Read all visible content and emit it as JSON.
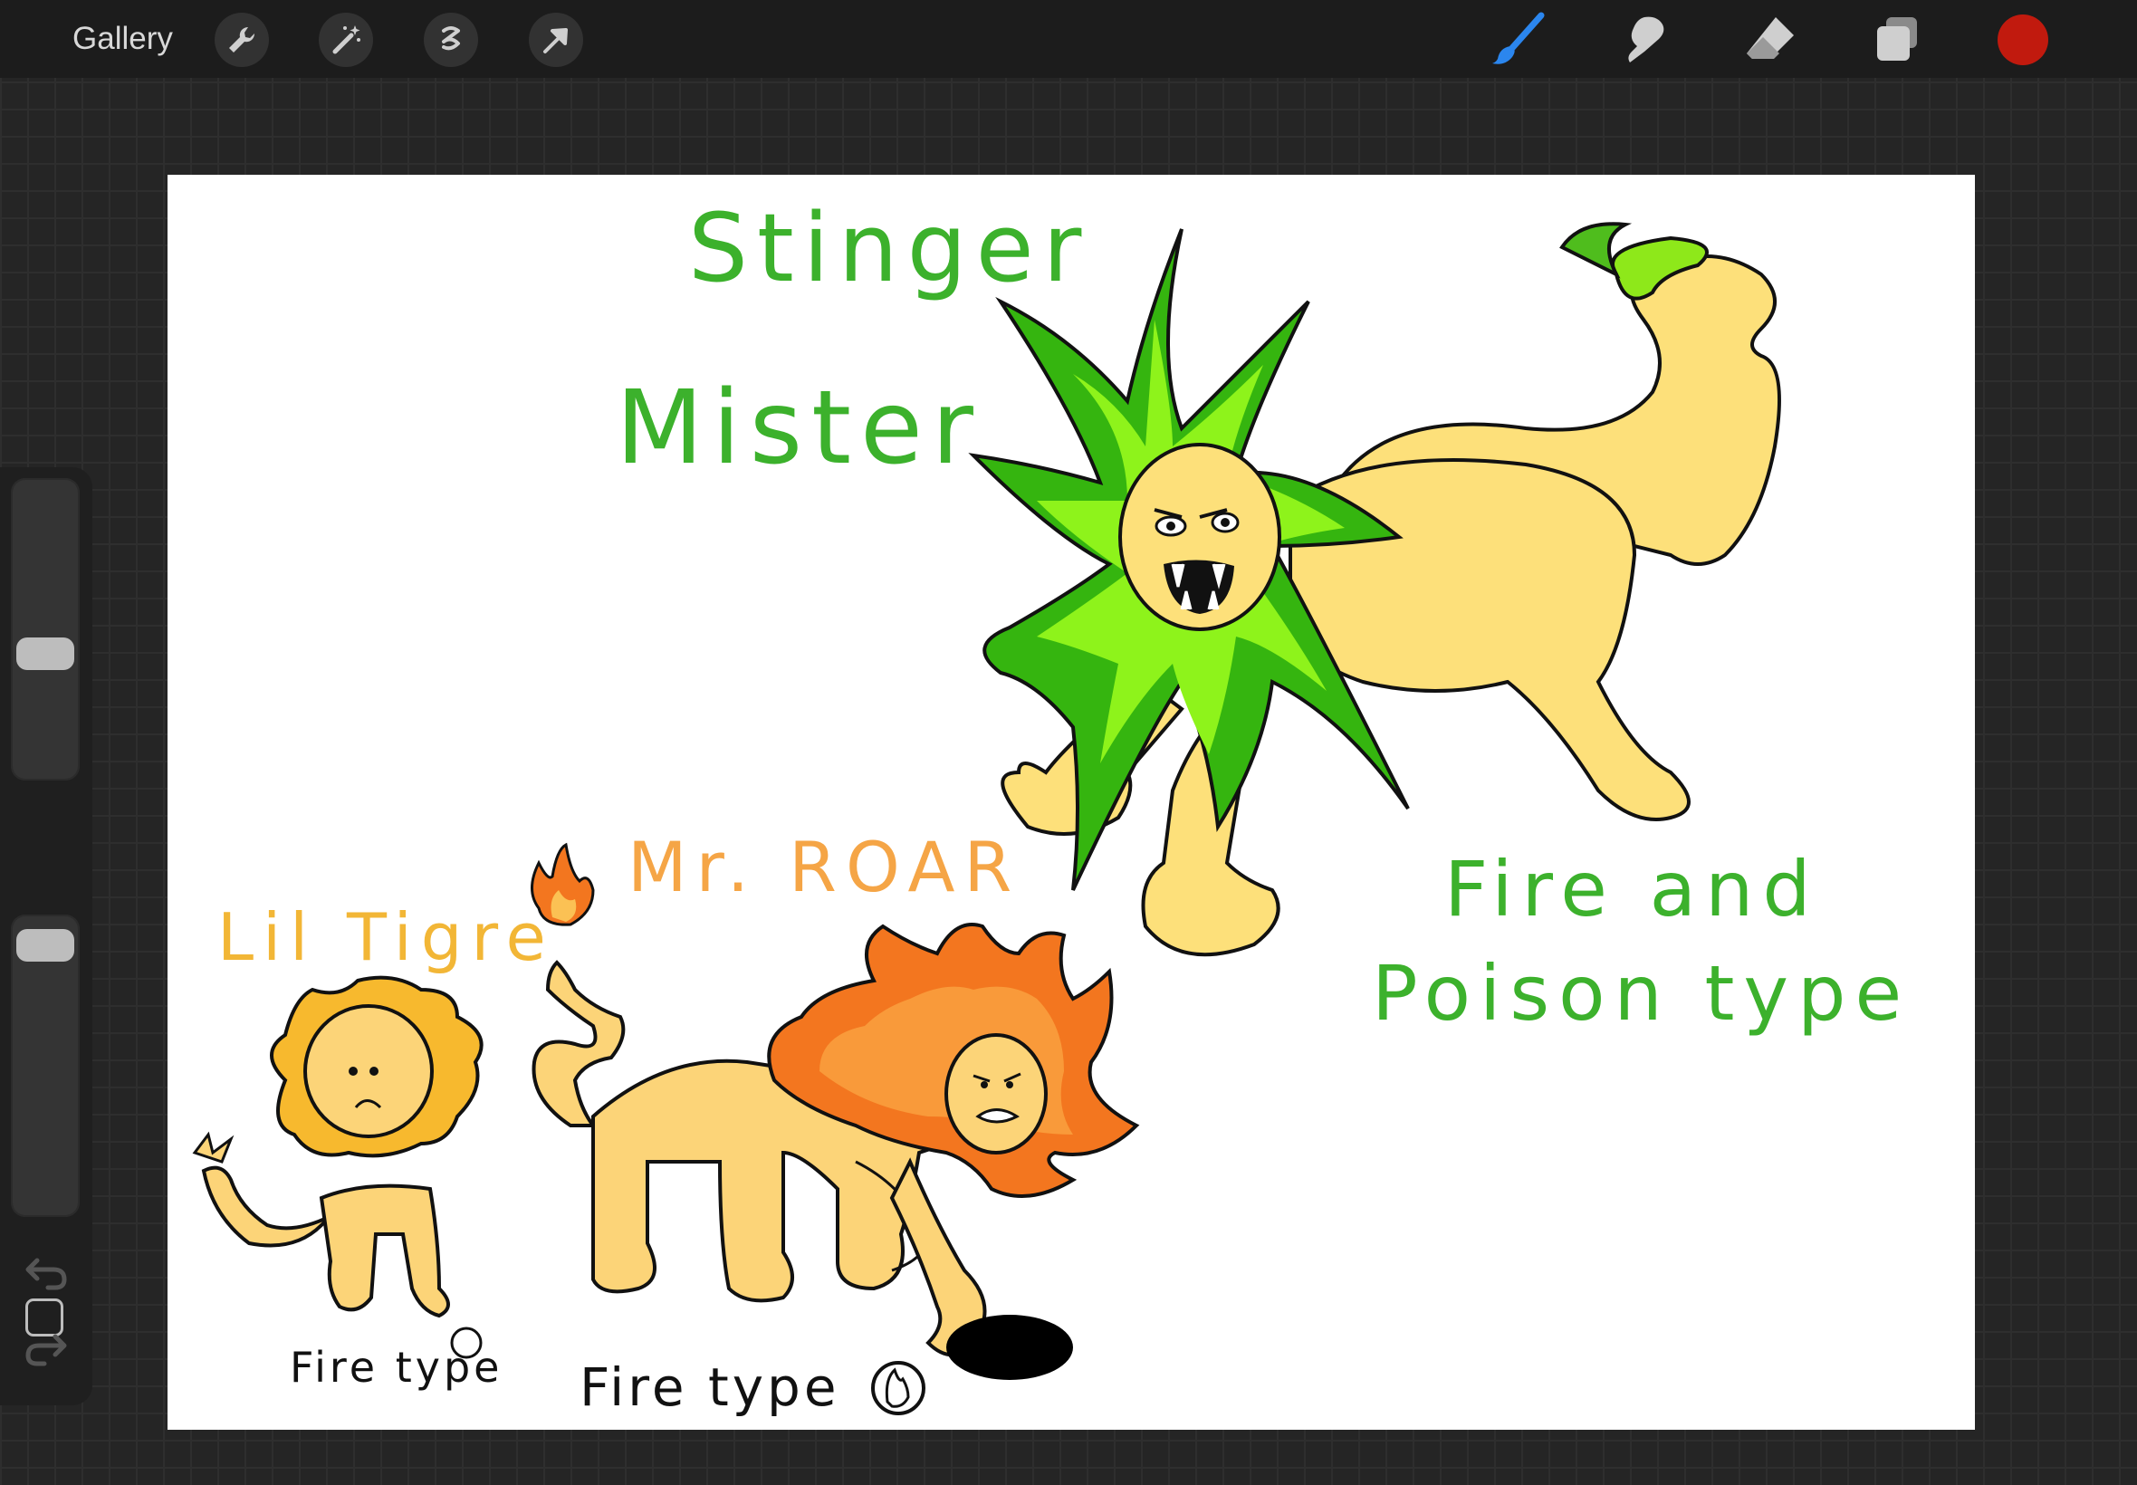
{
  "topbar": {
    "gallery_label": "Gallery",
    "left_tools": [
      "wrench-icon",
      "magic-wand-icon",
      "selection-icon",
      "transform-arrow-icon"
    ],
    "right_tools": [
      "brush-icon",
      "smudge-icon",
      "eraser-icon",
      "layers-icon"
    ],
    "current_color": "#c11a0e",
    "brush_color": "#1e6fe0"
  },
  "sidebar": {
    "size_slider_level": 0.62,
    "opacity_slider_level": 0.05
  },
  "canvas": {
    "labels": {
      "stinger": "Stinger",
      "mister": "Mister",
      "fire_and": "Fire and",
      "poison_type": "Poison type",
      "mr_roar": "Mr. ROAR",
      "lil_tigre": "Lil Tigre",
      "fire_type_1": "Fire type",
      "fire_type_2": "Fire type"
    },
    "colors": {
      "green_text": "#3cb12c",
      "orange_text": "#f5a546",
      "yellow_text": "#f2b636",
      "black_text": "#111111"
    }
  }
}
